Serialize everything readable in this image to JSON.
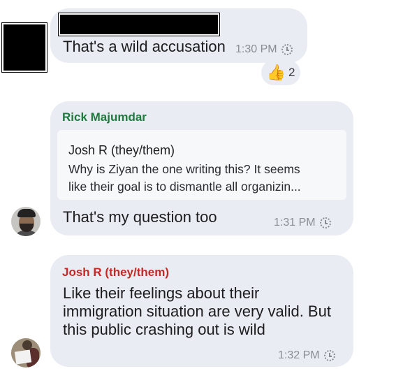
{
  "messages": [
    {
      "text": "That's a wild accusation",
      "time": "1:30 PM",
      "status_icon": "clock-pending-icon",
      "reaction": {
        "emoji": "👍",
        "count": "2"
      }
    },
    {
      "sender": "Rick Majumdar",
      "sender_color": "#1f7a3e",
      "quote": {
        "author": "Josh R (they/them)",
        "line1": "Why is Ziyan the one writing this? It seems",
        "line2": "like their goal is to dismantle all organizin..."
      },
      "text": "That's my question too",
      "time": "1:31 PM",
      "status_icon": "clock-pending-icon"
    },
    {
      "sender": "Josh R (they/them)",
      "sender_color": "#c62828",
      "line1": "Like their feelings about their",
      "line2": "immigration situation are very valid. But",
      "line3": "this public crashing out is wild",
      "time": "1:32 PM",
      "status_icon": "clock-pending-icon"
    }
  ],
  "colors": {
    "bubble": "#e9ecf2",
    "quote_bg": "#f7f8fa",
    "timestamp": "#8a8d94"
  }
}
